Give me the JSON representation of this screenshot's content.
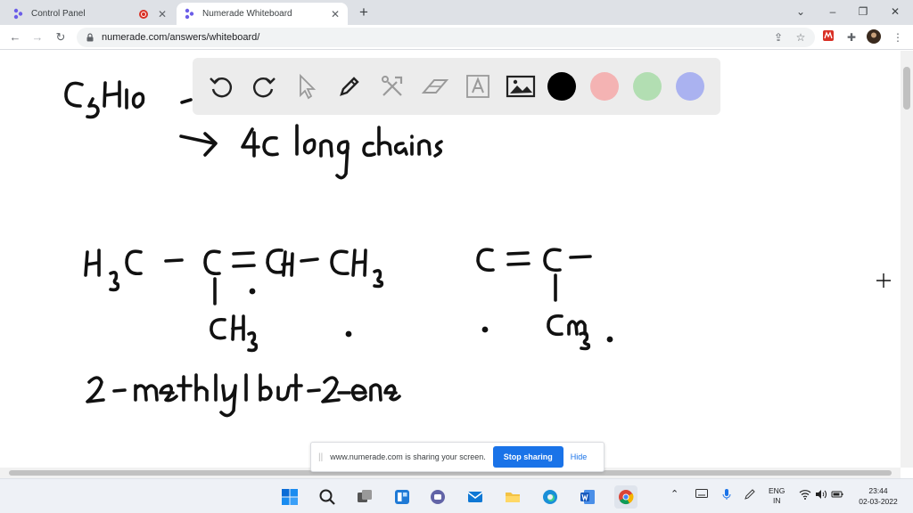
{
  "tabs": [
    {
      "title": "Control Panel",
      "active": false,
      "recording": true
    },
    {
      "title": "Numerade Whiteboard",
      "active": true,
      "recording": false
    }
  ],
  "address": {
    "url": "numerade.com/answers/whiteboard/"
  },
  "whiteboard": {
    "colors": [
      "#000000",
      "#f4b3b3",
      "#b2deb2",
      "#aab2f0"
    ],
    "handwriting": {
      "formula": "C5H10",
      "note": "4C long chains",
      "structure_left": "H3C - C = CH - CH3",
      "branch_left": "CH3",
      "structure_right": "C = C -",
      "branch_right": "CH3",
      "name": "2-methylbut-2-ene"
    }
  },
  "share_banner": {
    "message": "www.numerade.com is sharing your screen.",
    "stop_label": "Stop sharing",
    "hide_label": "Hide"
  },
  "taskbar": {
    "language_top": "ENG",
    "language_bottom": "IN",
    "time": "23:44",
    "date": "02-03-2022"
  }
}
